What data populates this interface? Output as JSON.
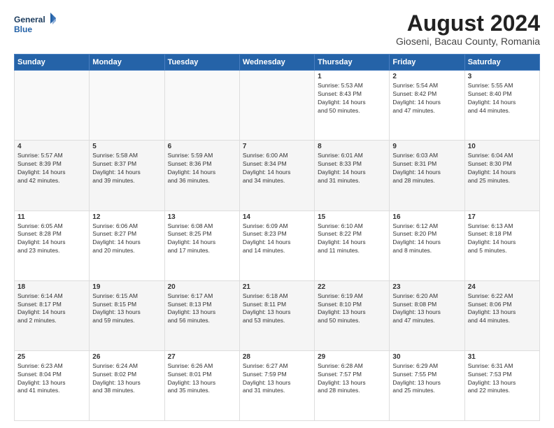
{
  "header": {
    "logo_line1": "General",
    "logo_line2": "Blue",
    "title": "August 2024",
    "subtitle": "Gioseni, Bacau County, Romania"
  },
  "weekdays": [
    "Sunday",
    "Monday",
    "Tuesday",
    "Wednesday",
    "Thursday",
    "Friday",
    "Saturday"
  ],
  "weeks": [
    [
      {
        "day": "",
        "info": ""
      },
      {
        "day": "",
        "info": ""
      },
      {
        "day": "",
        "info": ""
      },
      {
        "day": "",
        "info": ""
      },
      {
        "day": "1",
        "info": "Sunrise: 5:53 AM\nSunset: 8:43 PM\nDaylight: 14 hours\nand 50 minutes."
      },
      {
        "day": "2",
        "info": "Sunrise: 5:54 AM\nSunset: 8:42 PM\nDaylight: 14 hours\nand 47 minutes."
      },
      {
        "day": "3",
        "info": "Sunrise: 5:55 AM\nSunset: 8:40 PM\nDaylight: 14 hours\nand 44 minutes."
      }
    ],
    [
      {
        "day": "4",
        "info": "Sunrise: 5:57 AM\nSunset: 8:39 PM\nDaylight: 14 hours\nand 42 minutes."
      },
      {
        "day": "5",
        "info": "Sunrise: 5:58 AM\nSunset: 8:37 PM\nDaylight: 14 hours\nand 39 minutes."
      },
      {
        "day": "6",
        "info": "Sunrise: 5:59 AM\nSunset: 8:36 PM\nDaylight: 14 hours\nand 36 minutes."
      },
      {
        "day": "7",
        "info": "Sunrise: 6:00 AM\nSunset: 8:34 PM\nDaylight: 14 hours\nand 34 minutes."
      },
      {
        "day": "8",
        "info": "Sunrise: 6:01 AM\nSunset: 8:33 PM\nDaylight: 14 hours\nand 31 minutes."
      },
      {
        "day": "9",
        "info": "Sunrise: 6:03 AM\nSunset: 8:31 PM\nDaylight: 14 hours\nand 28 minutes."
      },
      {
        "day": "10",
        "info": "Sunrise: 6:04 AM\nSunset: 8:30 PM\nDaylight: 14 hours\nand 25 minutes."
      }
    ],
    [
      {
        "day": "11",
        "info": "Sunrise: 6:05 AM\nSunset: 8:28 PM\nDaylight: 14 hours\nand 23 minutes."
      },
      {
        "day": "12",
        "info": "Sunrise: 6:06 AM\nSunset: 8:27 PM\nDaylight: 14 hours\nand 20 minutes."
      },
      {
        "day": "13",
        "info": "Sunrise: 6:08 AM\nSunset: 8:25 PM\nDaylight: 14 hours\nand 17 minutes."
      },
      {
        "day": "14",
        "info": "Sunrise: 6:09 AM\nSunset: 8:23 PM\nDaylight: 14 hours\nand 14 minutes."
      },
      {
        "day": "15",
        "info": "Sunrise: 6:10 AM\nSunset: 8:22 PM\nDaylight: 14 hours\nand 11 minutes."
      },
      {
        "day": "16",
        "info": "Sunrise: 6:12 AM\nSunset: 8:20 PM\nDaylight: 14 hours\nand 8 minutes."
      },
      {
        "day": "17",
        "info": "Sunrise: 6:13 AM\nSunset: 8:18 PM\nDaylight: 14 hours\nand 5 minutes."
      }
    ],
    [
      {
        "day": "18",
        "info": "Sunrise: 6:14 AM\nSunset: 8:17 PM\nDaylight: 14 hours\nand 2 minutes."
      },
      {
        "day": "19",
        "info": "Sunrise: 6:15 AM\nSunset: 8:15 PM\nDaylight: 13 hours\nand 59 minutes."
      },
      {
        "day": "20",
        "info": "Sunrise: 6:17 AM\nSunset: 8:13 PM\nDaylight: 13 hours\nand 56 minutes."
      },
      {
        "day": "21",
        "info": "Sunrise: 6:18 AM\nSunset: 8:11 PM\nDaylight: 13 hours\nand 53 minutes."
      },
      {
        "day": "22",
        "info": "Sunrise: 6:19 AM\nSunset: 8:10 PM\nDaylight: 13 hours\nand 50 minutes."
      },
      {
        "day": "23",
        "info": "Sunrise: 6:20 AM\nSunset: 8:08 PM\nDaylight: 13 hours\nand 47 minutes."
      },
      {
        "day": "24",
        "info": "Sunrise: 6:22 AM\nSunset: 8:06 PM\nDaylight: 13 hours\nand 44 minutes."
      }
    ],
    [
      {
        "day": "25",
        "info": "Sunrise: 6:23 AM\nSunset: 8:04 PM\nDaylight: 13 hours\nand 41 minutes."
      },
      {
        "day": "26",
        "info": "Sunrise: 6:24 AM\nSunset: 8:02 PM\nDaylight: 13 hours\nand 38 minutes."
      },
      {
        "day": "27",
        "info": "Sunrise: 6:26 AM\nSunset: 8:01 PM\nDaylight: 13 hours\nand 35 minutes."
      },
      {
        "day": "28",
        "info": "Sunrise: 6:27 AM\nSunset: 7:59 PM\nDaylight: 13 hours\nand 31 minutes."
      },
      {
        "day": "29",
        "info": "Sunrise: 6:28 AM\nSunset: 7:57 PM\nDaylight: 13 hours\nand 28 minutes."
      },
      {
        "day": "30",
        "info": "Sunrise: 6:29 AM\nSunset: 7:55 PM\nDaylight: 13 hours\nand 25 minutes."
      },
      {
        "day": "31",
        "info": "Sunrise: 6:31 AM\nSunset: 7:53 PM\nDaylight: 13 hours\nand 22 minutes."
      }
    ]
  ]
}
